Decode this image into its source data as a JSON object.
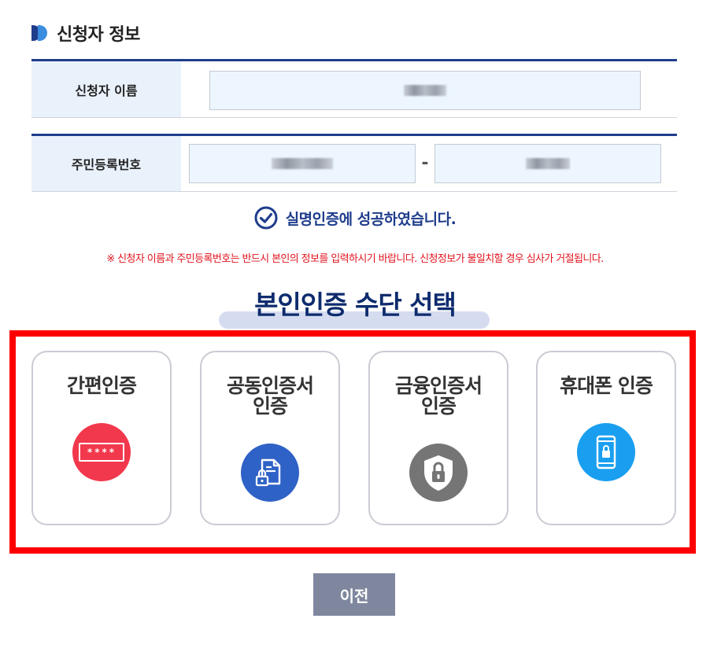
{
  "section": {
    "title": "신청자 정보"
  },
  "form": {
    "name_label": "신청자 이름",
    "rrn_label": "주민등록번호",
    "rrn_separator": "-"
  },
  "verification": {
    "message": "실명인증에 성공하였습니다."
  },
  "notice": "※ 신청자 이름과 주민등록번호는 반드시 본인의 정보를 입력하시기 바랍니다. 신청정보가 불일치할 경우 심사가 거절됩니다.",
  "methods": {
    "title": "본인인증 수단 선택",
    "items": [
      {
        "label": "간편인증",
        "icon": "password-icon",
        "color": "#f2384c",
        "icon_text": "****"
      },
      {
        "label": "공동인증서\n인증",
        "icon": "certificate-document-icon",
        "color": "#2f62c6"
      },
      {
        "label": "금융인증서\n인증",
        "icon": "shield-lock-icon",
        "color": "#757575"
      },
      {
        "label": "휴대폰 인증",
        "icon": "mobile-lock-icon",
        "color": "#1a9ff0"
      }
    ]
  },
  "buttons": {
    "prev": "이전"
  },
  "colors": {
    "primary": "#1f3d8c",
    "highlight": "#ff0000",
    "notice": "#e0141e"
  }
}
